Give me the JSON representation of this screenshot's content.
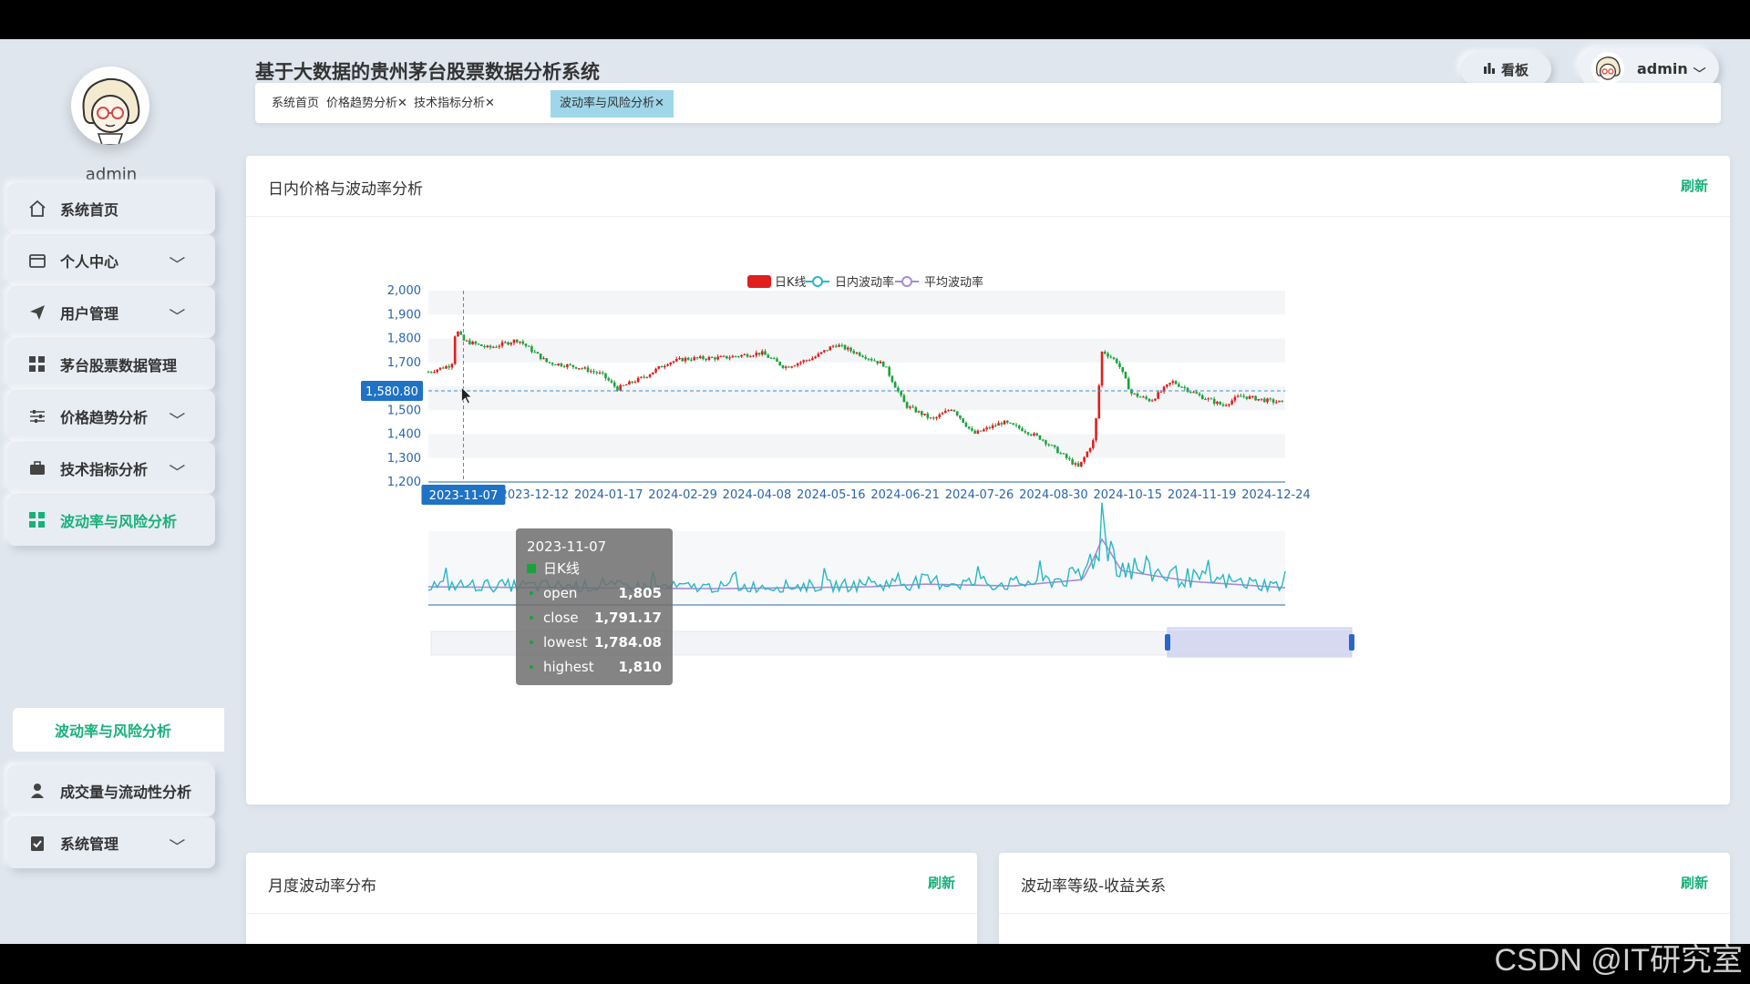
{
  "sidebar": {
    "username": "admin",
    "items": [
      {
        "label": "系统首页",
        "icon": "home-icon",
        "expandable": false
      },
      {
        "label": "个人中心",
        "icon": "id-card-icon",
        "expandable": true
      },
      {
        "label": "用户管理",
        "icon": "paper-plane-icon",
        "expandable": true
      },
      {
        "label": "茅台股票数据管理",
        "icon": "grid-icon",
        "expandable": false
      },
      {
        "label": "价格趋势分析",
        "icon": "sliders-icon",
        "expandable": true
      },
      {
        "label": "技术指标分析",
        "icon": "briefcase-icon",
        "expandable": true
      },
      {
        "label": "波动率与风险分析",
        "icon": "grid-icon",
        "expandable": false,
        "active": true
      },
      {
        "label": "成交量与流动性分析",
        "icon": "user-icon",
        "expandable": false
      },
      {
        "label": "系统管理",
        "icon": "clipboard-check-icon",
        "expandable": true
      }
    ],
    "active_sub": "波动率与风险分析"
  },
  "header": {
    "title": "基于大数据的贵州茅台股票数据分析系统",
    "board_label": "看板",
    "user_label": "admin",
    "tabs": [
      {
        "label": "系统首页",
        "closable": false
      },
      {
        "label": "价格趋势分析",
        "closable": true
      },
      {
        "label": "技术指标分析",
        "closable": true
      },
      {
        "label": "波动率与风险分析",
        "closable": true,
        "active": true
      }
    ],
    "close_glyph": "✕"
  },
  "main_card": {
    "title": "日内价格与波动率分析",
    "refresh": "刷新"
  },
  "card2": {
    "title": "月度波动率分布",
    "refresh": "刷新"
  },
  "card3": {
    "title": "波动率等级-收益关系",
    "refresh": "刷新"
  },
  "colors": {
    "accent": "#19b07a",
    "up": "#e01e1e",
    "down": "#1aa33a",
    "vol": "#26b8c4",
    "avg": "#a88bd4",
    "axis": "#2a66a8"
  },
  "chart_data": {
    "type": "candlestick",
    "legend": [
      "日K线",
      "日内波动率",
      "平均波动率"
    ],
    "y_ticks": [
      1200,
      1300,
      1400,
      1500,
      1600,
      1700,
      1800,
      1900,
      2000
    ],
    "ylim": [
      1200,
      2000
    ],
    "x_ticks": [
      "2023-11-07",
      "2023-12-12",
      "2024-01-17",
      "2024-02-29",
      "2024-04-08",
      "2024-05-16",
      "2024-06-21",
      "2024-07-26",
      "2024-08-30",
      "2024-10-15",
      "2024-11-19",
      "2024-12-24"
    ],
    "price_path": [
      [
        "2023-10-20",
        1660
      ],
      [
        "2023-11-01",
        1690
      ],
      [
        "2023-11-03",
        1840
      ],
      [
        "2023-11-07",
        1791
      ],
      [
        "2023-11-20",
        1760
      ],
      [
        "2023-12-05",
        1795
      ],
      [
        "2023-12-20",
        1700
      ],
      [
        "2024-01-05",
        1680
      ],
      [
        "2024-01-17",
        1650
      ],
      [
        "2024-01-25",
        1590
      ],
      [
        "2024-02-08",
        1640
      ],
      [
        "2024-02-20",
        1700
      ],
      [
        "2024-02-29",
        1715
      ],
      [
        "2024-03-20",
        1720
      ],
      [
        "2024-04-08",
        1740
      ],
      [
        "2024-04-20",
        1680
      ],
      [
        "2024-05-05",
        1720
      ],
      [
        "2024-05-16",
        1775
      ],
      [
        "2024-05-30",
        1730
      ],
      [
        "2024-06-10",
        1690
      ],
      [
        "2024-06-21",
        1520
      ],
      [
        "2024-07-05",
        1460
      ],
      [
        "2024-07-15",
        1510
      ],
      [
        "2024-07-26",
        1400
      ],
      [
        "2024-08-10",
        1450
      ],
      [
        "2024-08-20",
        1420
      ],
      [
        "2024-08-30",
        1380
      ],
      [
        "2024-09-18",
        1260
      ],
      [
        "2024-09-26",
        1380
      ],
      [
        "2024-09-30",
        1750
      ],
      [
        "2024-10-08",
        1700
      ],
      [
        "2024-10-15",
        1570
      ],
      [
        "2024-10-25",
        1540
      ],
      [
        "2024-11-05",
        1620
      ],
      [
        "2024-11-19",
        1560
      ],
      [
        "2024-12-01",
        1520
      ],
      [
        "2024-12-10",
        1560
      ],
      [
        "2024-12-24",
        1540
      ],
      [
        "2025-01-02",
        1530
      ]
    ],
    "volatility_path": [
      [
        "2023-10-20",
        1.2
      ],
      [
        "2024-01-01",
        1.1
      ],
      [
        "2024-03-15",
        1.0
      ],
      [
        "2024-06-01",
        1.2
      ],
      [
        "2024-07-01",
        1.5
      ],
      [
        "2024-08-15",
        1.3
      ],
      [
        "2024-09-20",
        2.0
      ],
      [
        "2024-09-26",
        4.5
      ],
      [
        "2024-09-30",
        6.5
      ],
      [
        "2024-10-10",
        3.0
      ],
      [
        "2024-11-15",
        1.8
      ],
      [
        "2025-01-02",
        1.1
      ]
    ],
    "crosshair": {
      "date": "2023-11-07",
      "price": "1,580.80"
    },
    "tooltip": {
      "date": "2023-11-07",
      "series": "日K线",
      "rows": [
        {
          "k": "open",
          "v": "1,805"
        },
        {
          "k": "close",
          "v": "1,791.17"
        },
        {
          "k": "lowest",
          "v": "1,784.08"
        },
        {
          "k": "highest",
          "v": "1,810"
        }
      ]
    },
    "zoom_range": [
      0.8,
      1.0
    ]
  },
  "watermark": "CSDN @IT研究室"
}
